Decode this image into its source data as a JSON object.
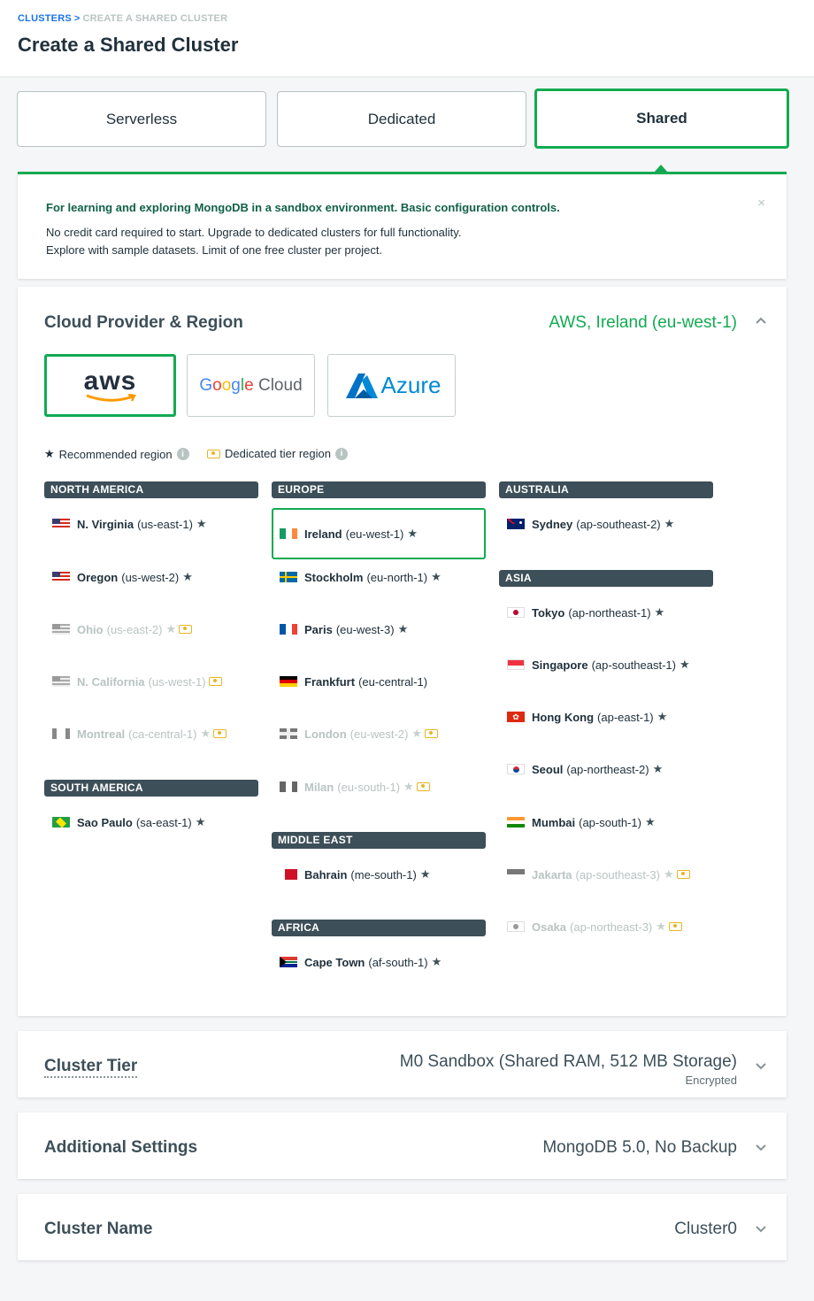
{
  "breadcrumb": {
    "link": "CLUSTERS",
    "sep": ">",
    "current": "CREATE A SHARED CLUSTER"
  },
  "page_title": "Create a Shared Cluster",
  "types": [
    {
      "label": "Serverless",
      "selected": false
    },
    {
      "label": "Dedicated",
      "selected": false
    },
    {
      "label": "Shared",
      "selected": true
    }
  ],
  "info": {
    "heading": "For learning and exploring MongoDB in a sandbox environment. Basic configuration controls.",
    "line1": "No credit card required to start. Upgrade to dedicated clusters for full functionality.",
    "line2": "Explore with sample datasets. Limit of one free cluster per project.",
    "close": "×"
  },
  "provider_section": {
    "title": "Cloud Provider & Region",
    "value": "AWS, Ireland (eu-west-1)",
    "providers": [
      "aws",
      "Google Cloud",
      "Azure"
    ],
    "legend_recommended": "Recommended region",
    "legend_dedicated": "Dedicated tier region"
  },
  "continents": {
    "na": "NORTH AMERICA",
    "sa": "SOUTH AMERICA",
    "eu": "EUROPE",
    "me": "MIDDLE EAST",
    "af": "AFRICA",
    "au": "AUSTRALIA",
    "as": "ASIA"
  },
  "regions": {
    "us_east_1": {
      "name": "N. Virginia",
      "code": "(us-east-1)"
    },
    "us_west_2": {
      "name": "Oregon",
      "code": "(us-west-2)"
    },
    "us_east_2": {
      "name": "Ohio",
      "code": "(us-east-2)"
    },
    "us_west_1": {
      "name": "N. California",
      "code": "(us-west-1)"
    },
    "ca_central_1": {
      "name": "Montreal",
      "code": "(ca-central-1)"
    },
    "sa_east_1": {
      "name": "Sao Paulo",
      "code": "(sa-east-1)"
    },
    "eu_west_1": {
      "name": "Ireland",
      "code": "(eu-west-1)"
    },
    "eu_north_1": {
      "name": "Stockholm",
      "code": "(eu-north-1)"
    },
    "eu_west_3": {
      "name": "Paris",
      "code": "(eu-west-3)"
    },
    "eu_central_1": {
      "name": "Frankfurt",
      "code": "(eu-central-1)"
    },
    "eu_west_2": {
      "name": "London",
      "code": "(eu-west-2)"
    },
    "eu_south_1": {
      "name": "Milan",
      "code": "(eu-south-1)"
    },
    "me_south_1": {
      "name": "Bahrain",
      "code": "(me-south-1)"
    },
    "af_south_1": {
      "name": "Cape Town",
      "code": "(af-south-1)"
    },
    "ap_southeast_2": {
      "name": "Sydney",
      "code": "(ap-southeast-2)"
    },
    "ap_northeast_1": {
      "name": "Tokyo",
      "code": "(ap-northeast-1)"
    },
    "ap_southeast_1": {
      "name": "Singapore",
      "code": "(ap-southeast-1)"
    },
    "ap_east_1": {
      "name": "Hong Kong",
      "code": "(ap-east-1)"
    },
    "ap_northeast_2": {
      "name": "Seoul",
      "code": "(ap-northeast-2)"
    },
    "ap_south_1": {
      "name": "Mumbai",
      "code": "(ap-south-1)"
    },
    "ap_southeast_3": {
      "name": "Jakarta",
      "code": "(ap-southeast-3)"
    },
    "ap_northeast_3": {
      "name": "Osaka",
      "code": "(ap-northeast-3)"
    }
  },
  "tier_section": {
    "title": "Cluster Tier",
    "value": "M0 Sandbox (Shared RAM, 512 MB Storage)",
    "sub": "Encrypted"
  },
  "settings_section": {
    "title": "Additional Settings",
    "value": "MongoDB 5.0, No Backup"
  },
  "name_section": {
    "title": "Cluster Name",
    "value": "Cluster0"
  },
  "colors": {
    "accent": "#13aa52",
    "dark": "#3d4f58",
    "link": "#1a73e8",
    "dedicated": "#e6b622"
  },
  "icons": [
    "star-icon",
    "info-icon",
    "dedicated-tier-icon",
    "chevron-up-icon",
    "chevron-down-icon",
    "close-icon"
  ]
}
